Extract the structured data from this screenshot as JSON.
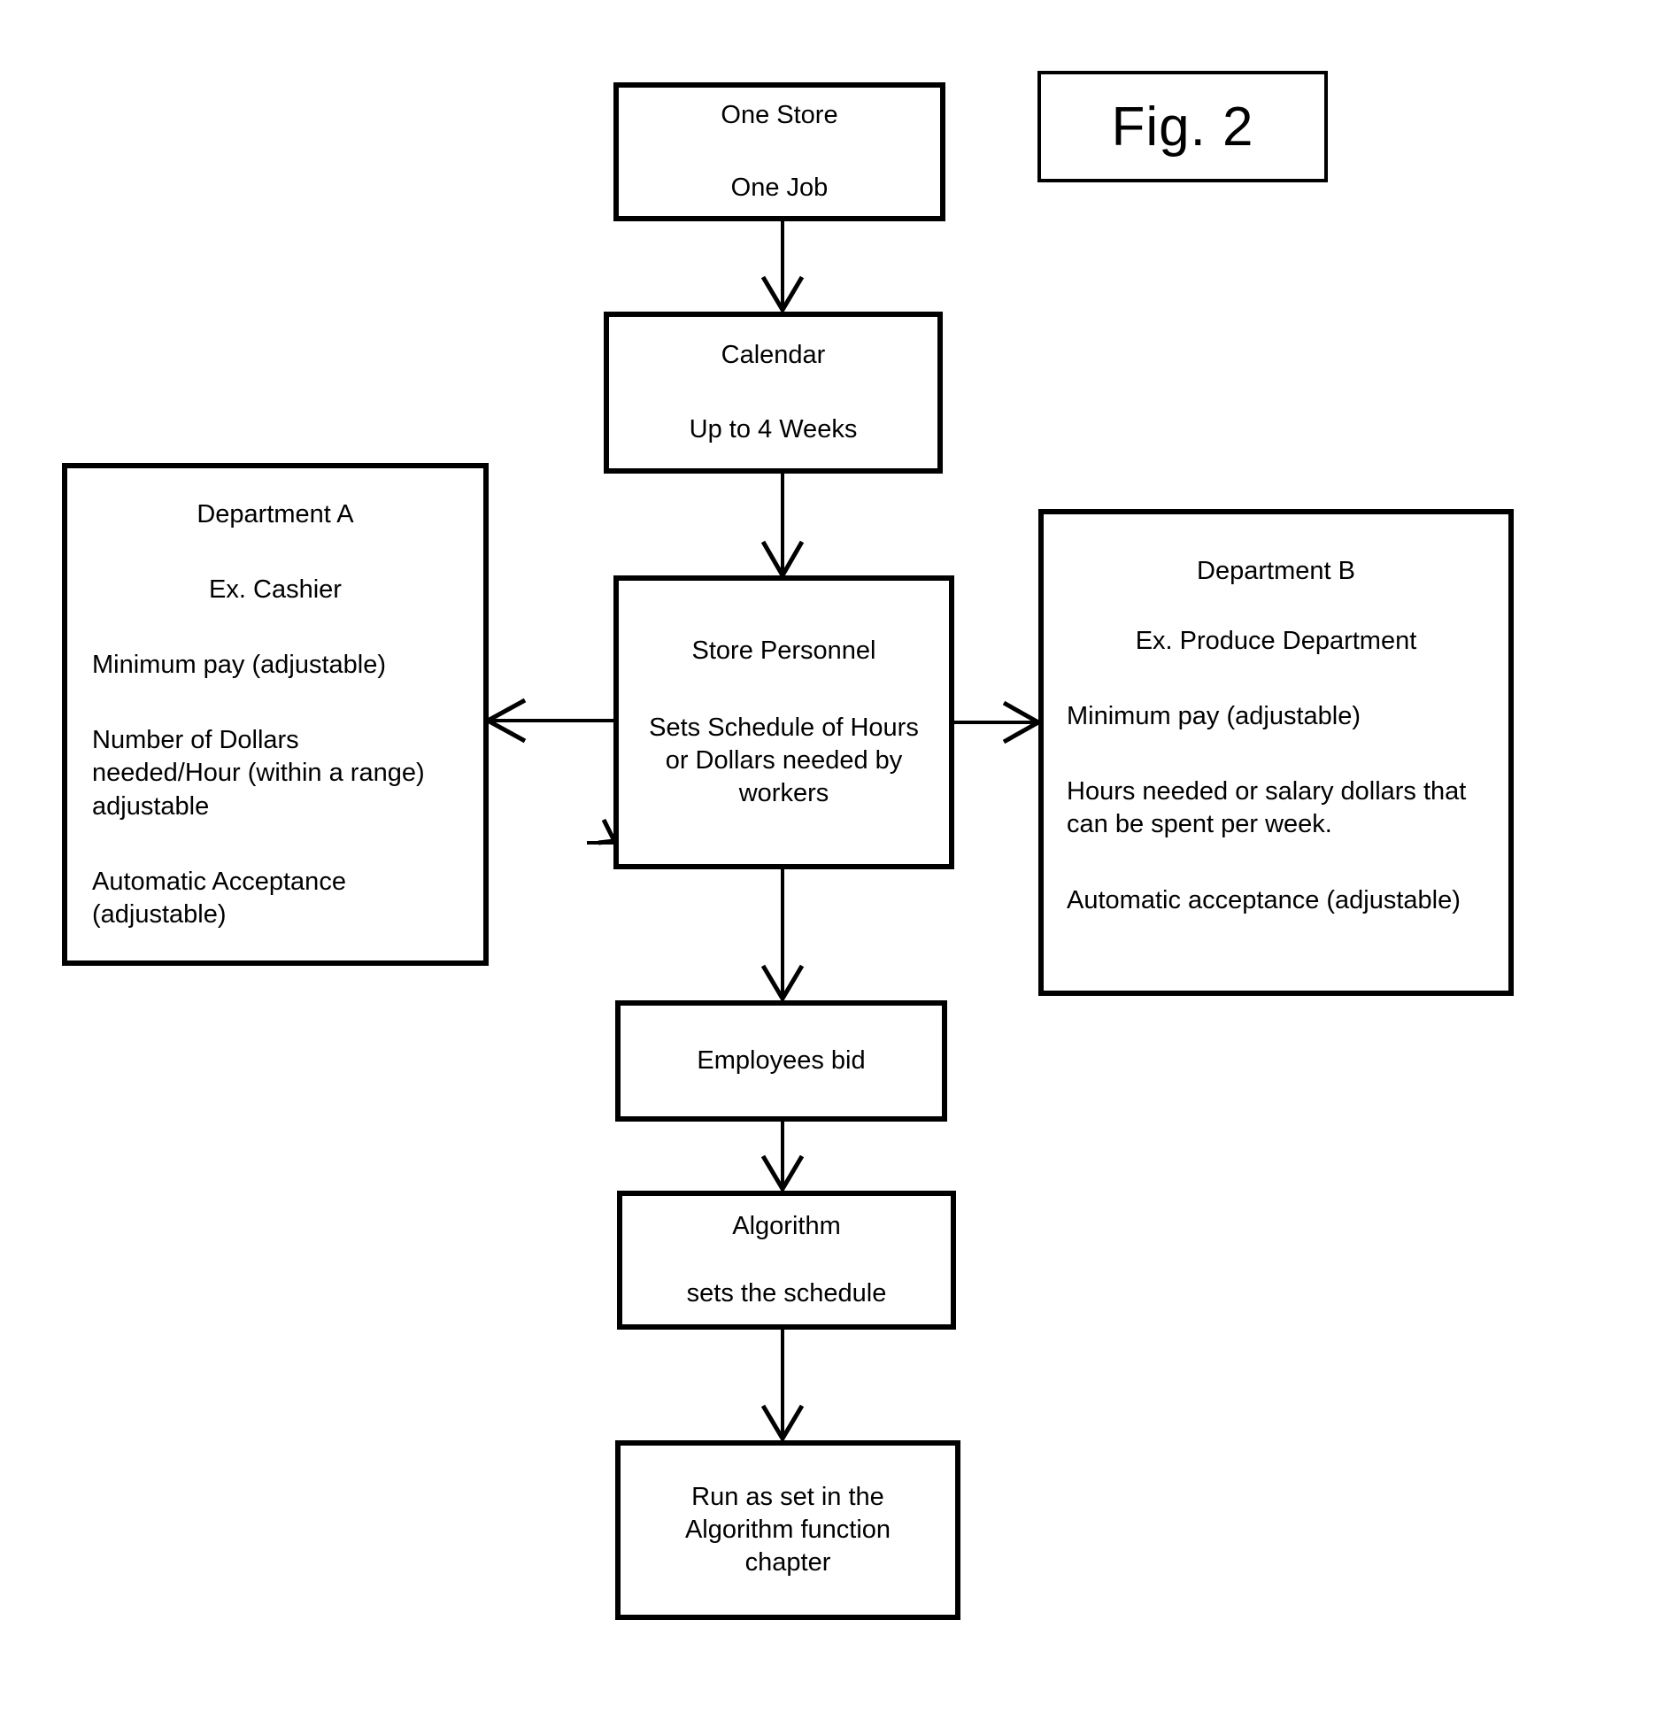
{
  "figure": {
    "label": "Fig. 2"
  },
  "nodes": {
    "one_store": {
      "line1": "One Store",
      "line2": "One Job"
    },
    "calendar": {
      "line1": "Calendar",
      "line2": "Up to 4 Weeks"
    },
    "department_a": {
      "line1": "Department A",
      "line2": "Ex. Cashier",
      "line3": "Minimum pay (adjustable)",
      "line4a": "Number of Dollars",
      "line4b": "needed/Hour (within a range)",
      "line4c": "adjustable",
      "line5a": "Automatic Acceptance",
      "line5b": "(adjustable)"
    },
    "store_personnel": {
      "line1": "Store Personnel",
      "line2a": "Sets Schedule of Hours",
      "line2b": "or Dollars needed by",
      "line2c": "workers"
    },
    "department_b": {
      "line1": "Department B",
      "line2": "Ex. Produce Department",
      "line3": "Minimum pay (adjustable)",
      "line4a": "Hours needed or salary dollars that",
      "line4b": "can be spent per week.",
      "line5": "Automatic acceptance (adjustable)"
    },
    "employees_bid": {
      "line1": "Employees bid"
    },
    "algorithm": {
      "line1": "Algorithm",
      "line2": "sets the schedule"
    },
    "run_as_set": {
      "line1": "Run as set in the",
      "line2": "Algorithm function",
      "line3": "chapter"
    }
  },
  "edges": [
    {
      "name": "one-store-to-calendar",
      "from": "one_store",
      "to": "calendar",
      "direction": "down"
    },
    {
      "name": "calendar-to-store-personnel",
      "from": "calendar",
      "to": "store_personnel",
      "direction": "down"
    },
    {
      "name": "store-personnel-to-department-a",
      "from": "store_personnel",
      "to": "department_a",
      "direction": "left"
    },
    {
      "name": "store-personnel-to-department-b",
      "from": "store_personnel",
      "to": "department_b",
      "direction": "right"
    },
    {
      "name": "store-personnel-inbound-stub",
      "from": "department_a",
      "to": "store_personnel",
      "direction": "right"
    },
    {
      "name": "store-personnel-to-employees-bid",
      "from": "store_personnel",
      "to": "employees_bid",
      "direction": "down"
    },
    {
      "name": "employees-bid-to-algorithm",
      "from": "employees_bid",
      "to": "algorithm",
      "direction": "down"
    },
    {
      "name": "algorithm-to-run-as-set",
      "from": "algorithm",
      "to": "run_as_set",
      "direction": "down"
    }
  ],
  "colors": {
    "stroke": "#000000",
    "fill": "#ffffff",
    "text": "#000000"
  }
}
